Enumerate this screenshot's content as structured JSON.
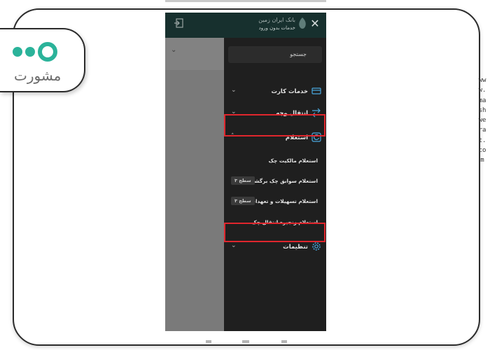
{
  "brand": {
    "logo_word": "مشورت",
    "watermark": "www.mashwerat.com"
  },
  "header": {
    "bank_name": "بانک ایران زمین",
    "bank_sub": "خدمات بدون ورود"
  },
  "search": {
    "placeholder": "جستجو"
  },
  "menu": {
    "items": [
      {
        "label": "خدمات کارت",
        "icon": "card-icon"
      },
      {
        "label": "انتقال وجه",
        "icon": "transfer-icon"
      },
      {
        "label": "استعلام",
        "icon": "refresh-icon",
        "expanded": true
      },
      {
        "label": "تنظیمات",
        "icon": "gear-icon"
      }
    ],
    "subitems": [
      {
        "label": "استعلام مالکیت چک",
        "badge": ""
      },
      {
        "label": "استعلام سوابق چک برگشتی",
        "badge": "سطح ۳"
      },
      {
        "label": "استعلام تسهیلات و تعهدات",
        "badge": "سطح ۳"
      },
      {
        "label": "استعلام زنجیره انتقال چک",
        "badge": ""
      }
    ]
  },
  "colors": {
    "accent_teal": "#2bb39a",
    "header_bg": "#17302e",
    "menu_bg": "#1f1f1f",
    "highlight_red": "#e0262d"
  }
}
